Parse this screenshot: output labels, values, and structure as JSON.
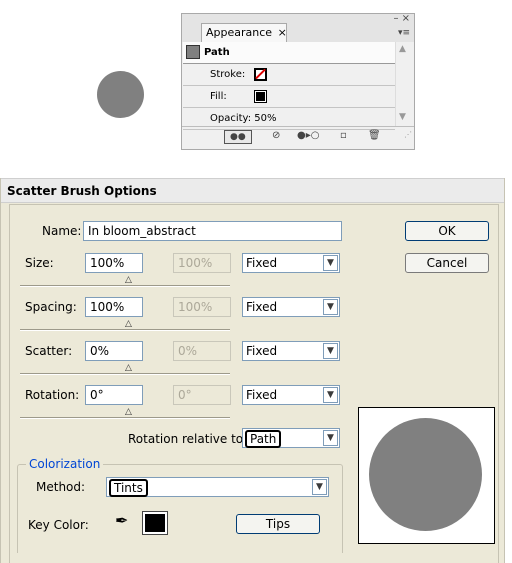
{
  "appearance_panel": {
    "tab_title": "Appearance",
    "tab_close": "×",
    "win_controls": "– ×",
    "menu_icon": "▾≡",
    "object_label": "Path",
    "rows": [
      {
        "label": "Stroke:"
      },
      {
        "label": "Fill:"
      },
      {
        "label": "Opacity: 50%"
      }
    ],
    "footer_icons": [
      "new-art-maintains-appearance-icon",
      "clear-appearance-icon",
      "reduce-to-basic-appearance-icon",
      "duplicate-item-icon",
      "delete-item-icon"
    ]
  },
  "dialog": {
    "title": "Scatter Brush Options",
    "name_label": "Name:",
    "name_value": "In bloom_abstract",
    "ok_label": "OK",
    "cancel_label": "Cancel",
    "params": [
      {
        "label": "Size:",
        "value": "100%",
        "max": "100%",
        "mode": "Fixed"
      },
      {
        "label": "Spacing:",
        "value": "100%",
        "max": "100%",
        "mode": "Fixed"
      },
      {
        "label": "Scatter:",
        "value": "0%",
        "max": "0%",
        "mode": "Fixed"
      },
      {
        "label": "Rotation:",
        "value": "0°",
        "max": "0°",
        "mode": "Fixed"
      }
    ],
    "rotation_relative_label": "Rotation relative to:",
    "rotation_relative_value": "Path",
    "colorization": {
      "legend": "Colorization",
      "method_label": "Method:",
      "method_value": "Tints",
      "key_color_label": "Key Color:",
      "tips_label": "Tips"
    },
    "colors": {
      "accent": "#0046d5",
      "preview_fill": "#808080",
      "key_color": "#000000"
    }
  }
}
